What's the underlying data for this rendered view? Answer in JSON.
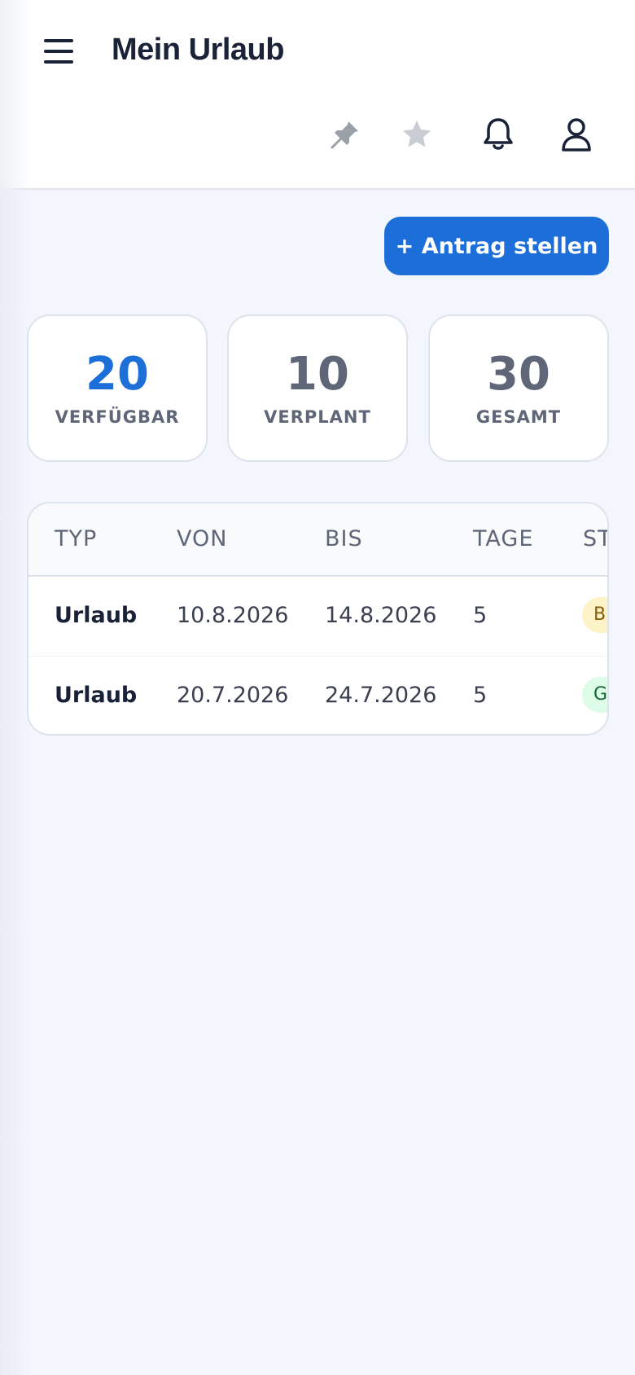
{
  "header": {
    "title": "Mein Urlaub",
    "icons": {
      "menu": "hamburger-menu-icon",
      "pin": "pin-icon",
      "favorite": "star-icon",
      "notifications": "bell-icon",
      "profile": "user-icon"
    }
  },
  "actions": {
    "new_request_label": "+ Antrag stellen"
  },
  "stats": [
    {
      "value": "20",
      "label": "VERFÜGBAR"
    },
    {
      "value": "10",
      "label": "VERPLANT"
    },
    {
      "value": "30",
      "label": "GESAMT"
    }
  ],
  "table": {
    "columns": [
      "TYP",
      "VON",
      "BIS",
      "TAGE",
      "ST"
    ],
    "rows": [
      {
        "type": "Urlaub",
        "from": "10.8.2026",
        "to": "14.8.2026",
        "days": "5",
        "status": "B"
      },
      {
        "type": "Urlaub",
        "from": "20.7.2026",
        "to": "24.7.2026",
        "days": "5",
        "status": "G"
      }
    ]
  },
  "colors": {
    "accent": "#1c6ed8",
    "text_dark": "#1a2238",
    "muted": "#5e6678",
    "background": "#f3f6fc",
    "status_pending_bg": "#fdf3c7",
    "status_approved_bg": "#dcfce7"
  }
}
